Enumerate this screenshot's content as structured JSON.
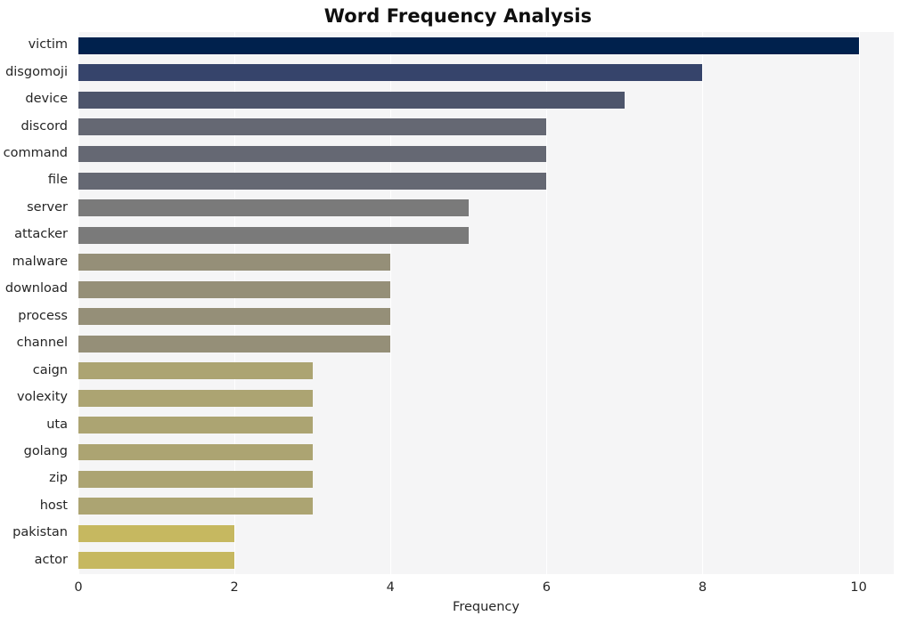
{
  "chart_data": {
    "type": "bar",
    "orientation": "horizontal",
    "title": "Word Frequency Analysis",
    "xlabel": "Frequency",
    "ylabel": "",
    "categories": [
      "victim",
      "disgomoji",
      "device",
      "discord",
      "command",
      "file",
      "server",
      "attacker",
      "malware",
      "download",
      "process",
      "channel",
      "caign",
      "volexity",
      "uta",
      "golang",
      "zip",
      "host",
      "pakistan",
      "actor"
    ],
    "values": [
      10,
      8,
      7,
      6,
      6,
      6,
      5,
      5,
      4,
      4,
      4,
      4,
      3,
      3,
      3,
      3,
      3,
      3,
      2,
      2
    ],
    "xlim": [
      0,
      10.45
    ],
    "xticks": [
      0,
      2,
      4,
      6,
      8,
      10
    ],
    "xtick_labels": [
      "0",
      "2",
      "4",
      "6",
      "8",
      "10"
    ],
    "grid": true,
    "grid_axis": "x",
    "grid_color": "#ffffff",
    "legend": false,
    "legend_position": "none",
    "plot_background": "#f5f5f6",
    "figure_background": "#ffffff",
    "colormap": "cividis",
    "bar_colors": [
      "#00214d",
      "#36446b",
      "#4d556b",
      "#656873",
      "#656873",
      "#656873",
      "#7a7a7a",
      "#7a7a7a",
      "#958f78",
      "#958f78",
      "#958f78",
      "#958f78",
      "#aca472",
      "#aca472",
      "#aca472",
      "#aca472",
      "#aca472",
      "#aca472",
      "#c6b860",
      "#c6b860"
    ]
  }
}
